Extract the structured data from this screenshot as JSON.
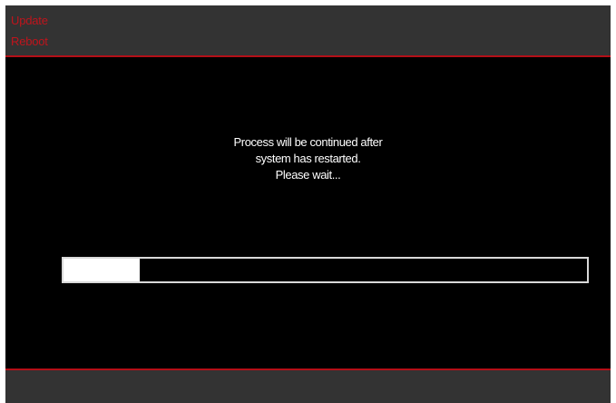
{
  "header": {
    "title_line1": "Update",
    "title_line2": "Reboot"
  },
  "message": {
    "line1": "Process will be continued after",
    "line2": "system has restarted.",
    "line3": "Please wait..."
  },
  "progress": {
    "fraction": 0.145
  },
  "colors": {
    "accent": "#c0141c",
    "bar_background": "#333333",
    "screen_background": "#000000",
    "text": "#ffffff"
  }
}
